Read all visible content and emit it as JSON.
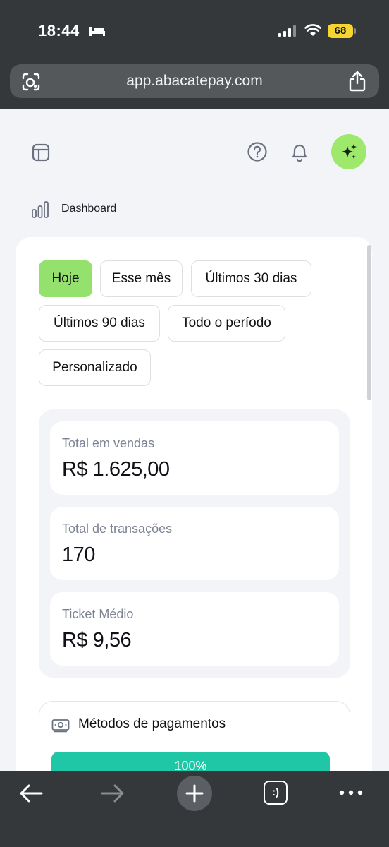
{
  "status_bar": {
    "time": "18:44",
    "battery": "68"
  },
  "browser": {
    "url": "app.abacatepay.com",
    "tabs_label": ":)"
  },
  "breadcrumb": {
    "label": "Dashboard"
  },
  "filters": {
    "active": "Hoje",
    "chips": [
      "Hoje",
      "Esse mês",
      "Últimos 30 dias",
      "Últimos 90 dias",
      "Todo o período",
      "Personalizado"
    ]
  },
  "stats": [
    {
      "label": "Total em vendas",
      "value": "R$ 1.625,00"
    },
    {
      "label": "Total de transações",
      "value": "170"
    },
    {
      "label": "Ticket Médio",
      "value": "R$ 9,56"
    }
  ],
  "payments": {
    "title": "Métodos de pagamentos",
    "bar_label": "100%",
    "percent": 100
  },
  "colors": {
    "accent_green": "#94e26d",
    "payment_bar": "#1fc7a6",
    "browser_chrome": "#34383b"
  }
}
